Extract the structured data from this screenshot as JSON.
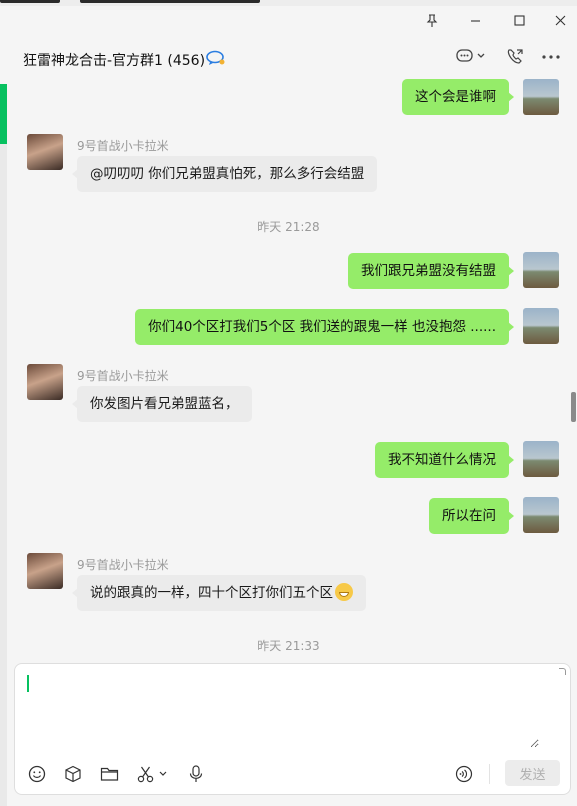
{
  "window": {
    "pin_icon": "pin-icon",
    "minimize_icon": "minimize-icon",
    "maximize_icon": "maximize-icon",
    "close_icon": "close-icon"
  },
  "header": {
    "title": "狂雷神龙合击-官方群1 (456)",
    "group_icon": "group-chat-icon",
    "chat_icon": "chat-bubble-icon",
    "call_icon": "phone-icon",
    "more_icon": "more-icon"
  },
  "messages": [
    {
      "side": "out",
      "text": "这个会是谁啊"
    },
    {
      "side": "in",
      "sender": "9号首战小卡拉米",
      "text": "@叨叨叨 你们兄弟盟真怕死，那么多行会结盟"
    },
    {
      "type": "time",
      "text": "昨天 21:28"
    },
    {
      "side": "out",
      "text": "我们跟兄弟盟没有结盟"
    },
    {
      "side": "out",
      "text": "你们40个区打我们5个区 我们送的跟鬼一样 也没抱怨 ......"
    },
    {
      "side": "in",
      "sender": "9号首战小卡拉米",
      "text": "你发图片看兄弟盟蓝名，"
    },
    {
      "side": "out",
      "text": "我不知道什么情况"
    },
    {
      "side": "out",
      "text": "所以在问"
    },
    {
      "side": "in",
      "sender": "9号首战小卡拉米",
      "text": "说的跟真的一样，四十个区打你们五个区",
      "emoji": "grinning-emoji"
    },
    {
      "type": "time",
      "text": "昨天 21:33"
    }
  ],
  "composer": {
    "value": "",
    "tools": [
      "emoji-icon",
      "box-icon",
      "folder-icon",
      "scissors-icon",
      "microphone-icon",
      "voice-input-icon"
    ],
    "send_label": "发送"
  },
  "colors": {
    "accent": "#07c160",
    "outgoing_bubble": "#95ec69",
    "incoming_bubble": "#ebebeb"
  }
}
